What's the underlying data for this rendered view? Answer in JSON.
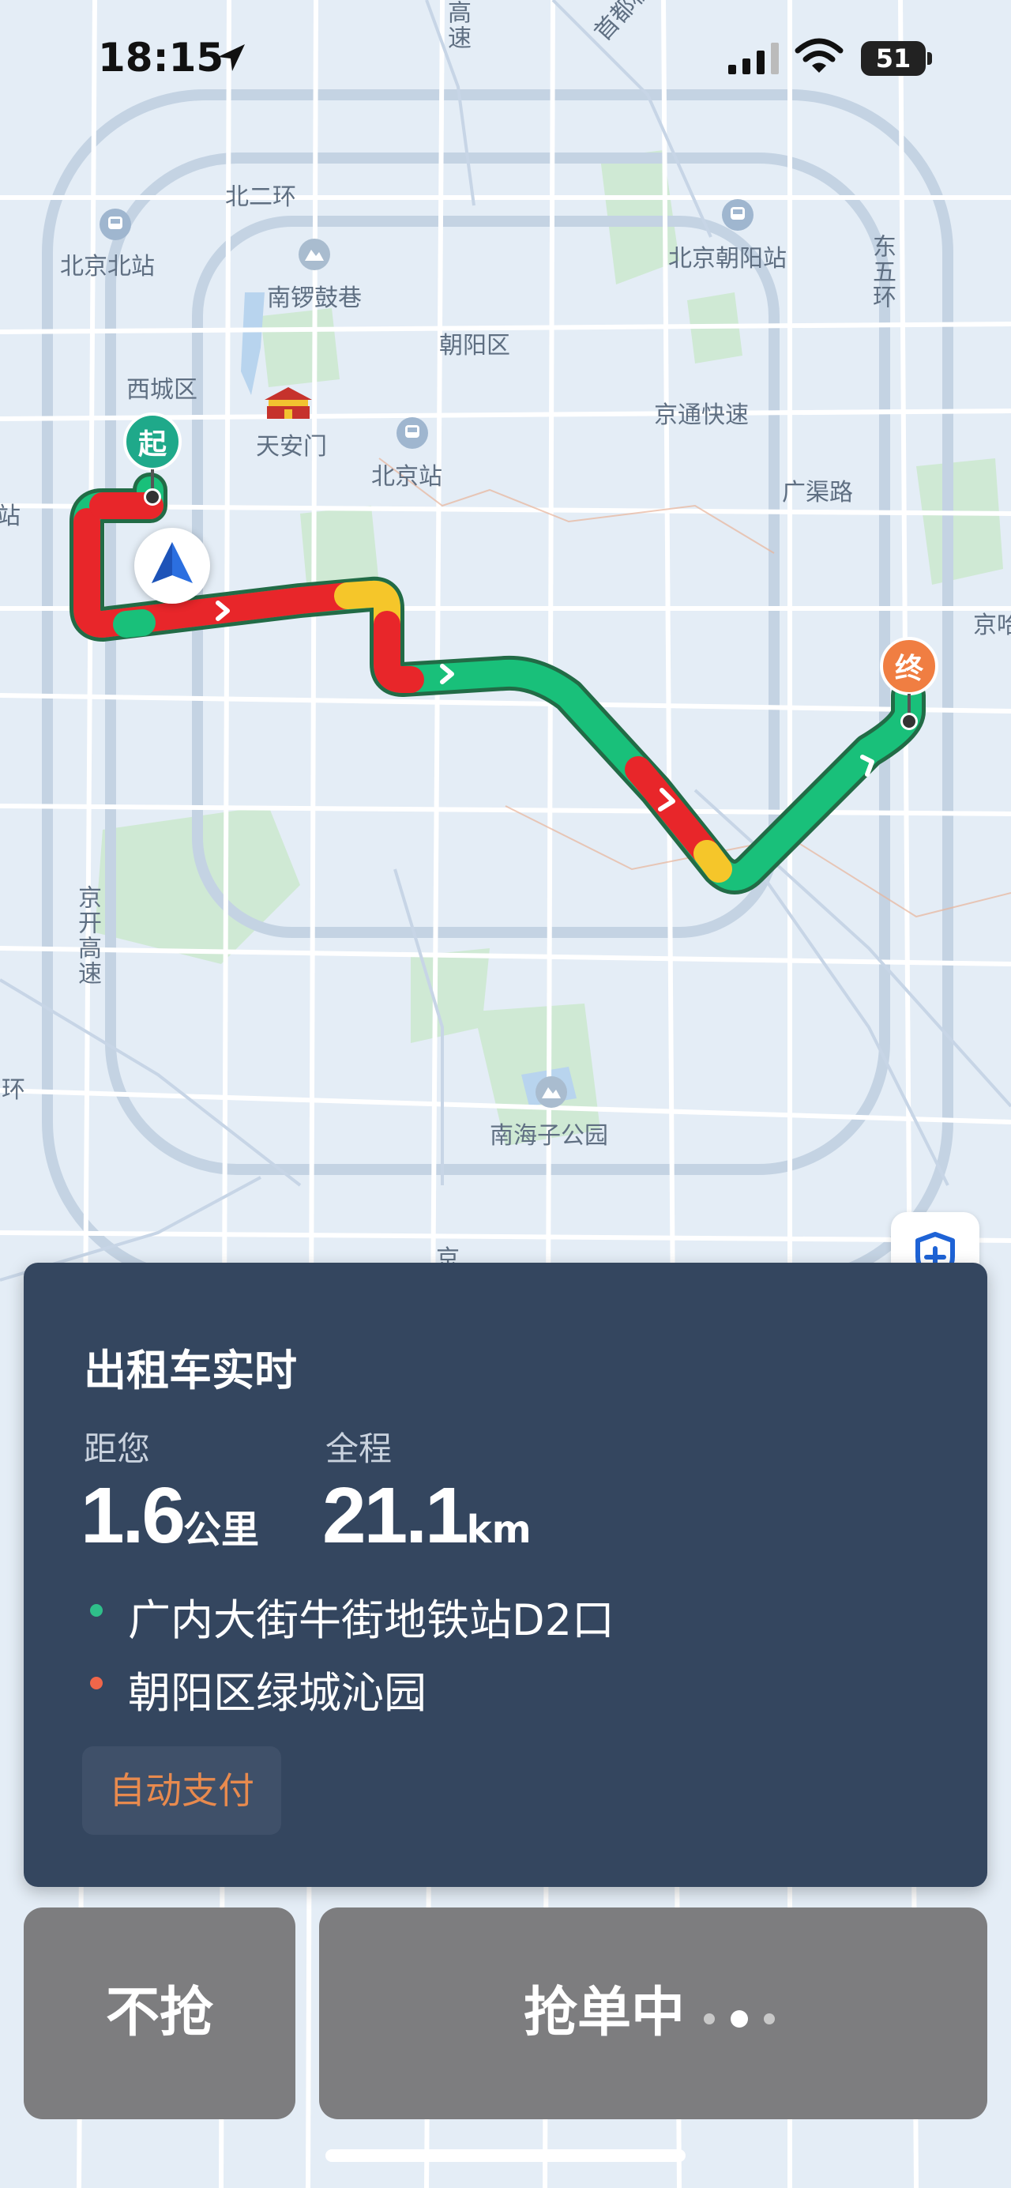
{
  "status_bar": {
    "time": "18:15",
    "battery": "51"
  },
  "map_labels": {
    "beierhuan": "北二环",
    "beijing_north_station": "北京北站",
    "nanluoguxiang": "南锣鼓巷",
    "beijing_chaoyang_station": "北京朝阳站",
    "dongwuhuan": "东五环",
    "xichengqu": "西城区",
    "chaoyangqu": "朝阳区",
    "tiananmen": "天安门",
    "jingtong_expressway": "京通快速",
    "beijing_station": "北京站",
    "guangqu_road": "广渠路",
    "west_station_partial": "西站",
    "jing_partial": "京哈",
    "jingkai_expressway": "京开高速",
    "huan_partial": "三环",
    "nanhaizi_park": "南海子公园",
    "jing_partial_2": "京",
    "airport_expressway": "首都机场高速",
    "gaosu_partial": "高速"
  },
  "markers": {
    "start": "起",
    "end": "终"
  },
  "card": {
    "title": "出租车实时",
    "distance_label": "距您",
    "distance_value": "1.6",
    "distance_unit": "公里",
    "total_label": "全程",
    "total_value": "21.1",
    "total_unit": "km",
    "pickup": "广内大街牛街地铁站D2口",
    "dropoff": "朝阳区绿城沁园",
    "tag": "自动支付"
  },
  "colors": {
    "pickup_dot": "#2fbf8a",
    "dropoff_dot": "#f0664a",
    "route_green": "#19c07a",
    "route_red": "#e8262a",
    "route_yellow": "#f5c62a"
  },
  "buttons": {
    "skip": "不抢",
    "grab": "抢单中"
  }
}
